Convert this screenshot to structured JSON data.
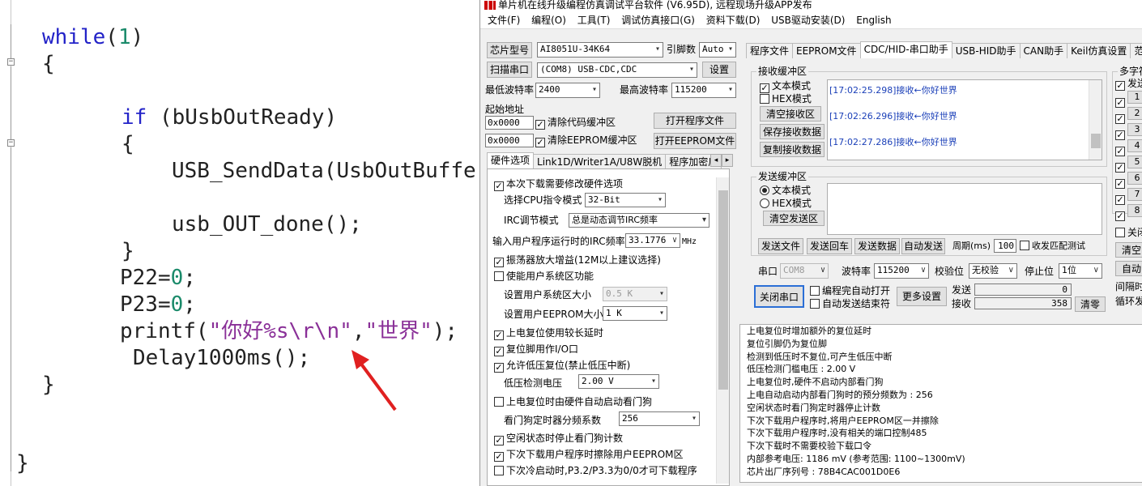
{
  "code": {
    "lines": [
      {
        "p": [
          {
            "t": "while",
            "c": "kw"
          },
          {
            "t": "(",
            "c": "pl"
          },
          {
            "t": "1",
            "c": "num"
          },
          {
            "t": ")",
            "c": "pl"
          }
        ]
      },
      {
        "p": [
          {
            "t": "{",
            "c": "pl"
          }
        ]
      },
      {
        "p": [
          {
            "t": "if",
            "c": "kw"
          },
          {
            "t": " (bUsbOutReady)",
            "c": "pl"
          }
        ]
      },
      {
        "p": [
          {
            "t": "{",
            "c": "pl"
          }
        ]
      },
      {
        "p": [
          {
            "t": "USB_SendData(UsbOutBuffer",
            "c": "pl"
          }
        ]
      },
      {
        "p": [
          {
            "t": "usb_OUT_done();",
            "c": "pl"
          }
        ]
      },
      {
        "p": [
          {
            "t": "}",
            "c": "pl"
          }
        ]
      },
      {
        "p": [
          {
            "t": "P22=",
            "c": "pl"
          },
          {
            "t": "0",
            "c": "num"
          },
          {
            "t": ";",
            "c": "pl"
          }
        ]
      },
      {
        "p": [
          {
            "t": "P23=",
            "c": "pl"
          },
          {
            "t": "0",
            "c": "num"
          },
          {
            "t": ";",
            "c": "pl"
          }
        ]
      },
      {
        "p": [
          {
            "t": "printf(",
            "c": "pl"
          },
          {
            "t": "\"你好%s\\r\\n\"",
            "c": "str"
          },
          {
            "t": ",",
            "c": "pl"
          },
          {
            "t": "\"世界\"",
            "c": "str"
          },
          {
            "t": ");",
            "c": "pl"
          }
        ]
      },
      {
        "p": [
          {
            "t": "Delay1000ms();",
            "c": "pl"
          }
        ]
      },
      {
        "p": [
          {
            "t": "}",
            "c": "pl"
          }
        ]
      },
      {
        "p": [
          {
            "t": "}",
            "c": "pl"
          }
        ]
      }
    ],
    "fold_glyph": "−"
  },
  "window": {
    "title": "单片机在线升级编程仿真调试平台软件 (V6.95D), 远程现场升级APP发布",
    "menu": [
      "文件(F)",
      "编程(O)",
      "工具(T)",
      "调试仿真接口(G)",
      "资料下载(D)",
      "USB驱动安装(D)",
      "English"
    ]
  },
  "left": {
    "chip_label": "芯片型号",
    "chip_value": "AI8051U-34K64",
    "pin_label": "引脚数",
    "pin_value": "Auto",
    "scan_label": "扫描串口",
    "port_value": "(COM8) USB-CDC,CDC",
    "settings_label": "设置",
    "min_baud_label": "最低波特率",
    "min_baud_value": "2400",
    "max_baud_label": "最高波特率",
    "max_baud_value": "115200",
    "start_addr_label": "起始地址",
    "addr1": "0x0000",
    "clear_code_label": "清除代码缓冲区",
    "open_prog_label": "打开程序文件",
    "addr2": "0x0000",
    "clear_eeprom_label": "清除EEPROM缓冲区",
    "open_eeprom_label": "打开EEPROM文件",
    "tabs": [
      "硬件选项",
      "Link1D/Writer1A/U8W脱机",
      "程序加密后"
    ],
    "tab_arrows": [
      "◂",
      "▸"
    ]
  },
  "hw": {
    "r1": "本次下载需要修改硬件选项",
    "cpu_mode_label": "选择CPU指令模式",
    "cpu_mode_value": "32-Bit",
    "irc_label": "IRC调节模式",
    "irc_value": "总是动态调节IRC频率",
    "freq_label": "输入用户程序运行时的IRC频率",
    "freq_value": "33.1776",
    "freq_unit": "MHz",
    "osc": "振荡器放大增益(12M以上建议选择)",
    "sys_area": "使能用户系统区功能",
    "sys_size_label": "设置用户系统区大小",
    "sys_size_value": "0.5 K",
    "eeprom_size_label": "设置用户EEPROM大小",
    "eeprom_size_value": "1   K",
    "delay": "上电复位使用较长延时",
    "reset_pin": "复位脚用作I/O口",
    "lvr": "允许低压复位(禁止低压中断)",
    "lvd_label": "低压检测电压",
    "lvd_value": "2.00 V",
    "wdt_auto": "上电复位时由硬件自动启动看门狗",
    "wdt_div_label": "看门狗定时器分频系数",
    "wdt_div_value": "256",
    "wdt_idle": "空闲状态时停止看门狗计数",
    "erase_eeprom": "下次下载用户程序时擦除用户EEPROM区",
    "cold_boot": "下次冷启动时,P3.2/P3.3为0/0才可下载程序"
  },
  "right": {
    "tabs": [
      "程序文件",
      "EEPROM文件",
      "CDC/HID-串口助手",
      "USB-HID助手",
      "CAN助手",
      "Keil仿真设置",
      "范例程"
    ],
    "recv_group": "接收缓冲区",
    "text_mode": "文本模式",
    "hex_mode": "HEX模式",
    "clear_recv": "清空接收区",
    "save_recv": "保存接收数据",
    "copy_recv": "复制接收数据",
    "recv_lines": [
      "[17:02:25.298]接收←你好世界",
      "[17:02:26.296]接收←你好世界",
      "[17:02:27.286]接收←你好世界"
    ],
    "send_group": "发送缓冲区",
    "clear_send": "清空发送区",
    "send_file": "发送文件",
    "send_enter": "发送回车",
    "send_data": "发送数据",
    "auto_send": "自动发送",
    "period_label": "周期(ms)",
    "period_value": "100",
    "match_label": "收发匹配测试",
    "port_label": "串口",
    "port_value": "COM8",
    "baud_label": "波特率",
    "baud_value": "115200",
    "parity_label": "校验位",
    "parity_value": "无校验",
    "stop_label": "停止位",
    "stop_value": "1位",
    "close_port": "关闭串口",
    "auto_open": "编程完自动打开",
    "auto_end": "自动发送结束符",
    "more_settings": "更多设置",
    "sent_label": "发送",
    "sent_value": "0",
    "recvd_label": "接收",
    "recvd_value": "358",
    "clear_zero": "清零",
    "multi_group": "多字符",
    "multi_send": "发送",
    "multi_rows": [
      "1",
      "2",
      "3",
      "4",
      "5",
      "6",
      "7",
      "8"
    ],
    "close_cb": "关闭",
    "clear_btn": "清空",
    "auto_btn": "自动",
    "interval_label": "间隔时",
    "loop_label": "循环发"
  },
  "info_lines": [
    "  上电复位时增加额外的复位延时",
    "  复位引脚仍为复位脚",
    "  检测到低压时不复位,可产生低压中断",
    "  低压检测门槛电压 : 2.00 V",
    "  上电复位时,硬件不启动内部看门狗",
    "  上电自动启动内部看门狗时的预分频数为 : 256",
    "  空闲状态时看门狗定时器停止计数",
    "  下次下载用户程序时,将用户EEPROM区一并擦除",
    "  下次下载用户程序时,没有相关的端口控制485",
    "  下次下载时不需要校验下载口令",
    "  内部参考电压: 1186 mV (参考范围: 1100~1300mV)",
    "芯片出厂序列号 : 78B4CAC001D0E6"
  ],
  "colors": {
    "keyword": "#2323c8",
    "number": "#1a8a6a",
    "string": "#8a3098",
    "recv_text": "#1a3fb8",
    "arrow": "#e02020"
  }
}
